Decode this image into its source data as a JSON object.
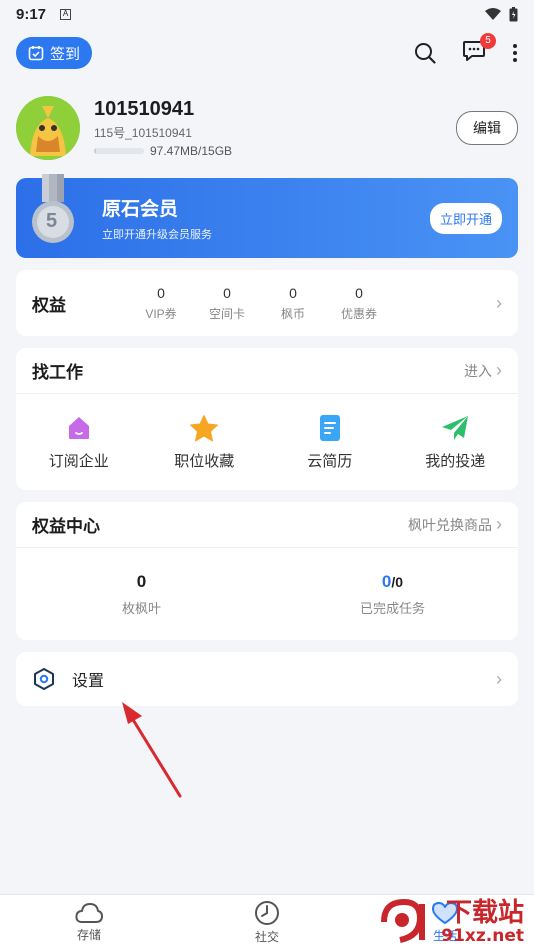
{
  "status_bar": {
    "time": "9:17",
    "sim_letter": "A"
  },
  "top_bar": {
    "signin_label": "签到",
    "message_badge": "5"
  },
  "profile": {
    "username": "101510941",
    "account_id": "115号_101510941",
    "storage_text": "97.47MB/15GB",
    "storage_used_fraction": 0.0063,
    "edit_label": "编辑"
  },
  "vip_banner": {
    "medal_number": "5",
    "title": "原石会员",
    "subtitle": "立即开通升级会员服务",
    "open_label": "立即开通"
  },
  "rights": {
    "label": "权益",
    "stats": [
      {
        "value": "0",
        "label": "VIP券"
      },
      {
        "value": "0",
        "label": "空间卡"
      },
      {
        "value": "0",
        "label": "枫币"
      },
      {
        "value": "0",
        "label": "优惠券"
      }
    ]
  },
  "jobs": {
    "title": "找工作",
    "enter_label": "进入",
    "items": [
      {
        "label": "订阅企业"
      },
      {
        "label": "职位收藏"
      },
      {
        "label": "云简历"
      },
      {
        "label": "我的投递"
      }
    ]
  },
  "benefit_center": {
    "title": "权益中心",
    "link_label": "枫叶兑换商品",
    "leaves_value": "0",
    "leaves_label": "枚枫叶",
    "tasks_done": "0",
    "tasks_total": "/0",
    "tasks_label": "已完成任务"
  },
  "settings": {
    "label": "设置"
  },
  "tab_bar": {
    "tabs": [
      {
        "label": "存储"
      },
      {
        "label": "社交"
      },
      {
        "label": "生活"
      }
    ]
  },
  "watermark": {
    "line1": "下载站",
    "line2": "91xz.net"
  },
  "colors": {
    "accent": "#2b78f0",
    "badge": "#f03a3a",
    "arrow": "#d9282f"
  }
}
